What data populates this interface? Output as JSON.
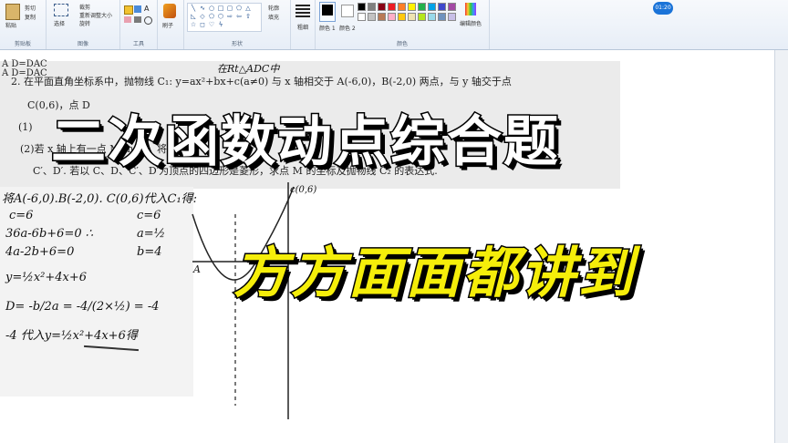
{
  "ribbon": {
    "clipboard": {
      "paste": "粘贴",
      "cut": "剪切",
      "copy": "复制",
      "label": "剪贴板"
    },
    "image": {
      "select": "选择",
      "crop": "裁剪",
      "resize": "重新调整大小",
      "rotate": "旋转",
      "label": "图像"
    },
    "tools": {
      "label": "工具"
    },
    "brushes": {
      "label": "刷子"
    },
    "shapes": {
      "outline": "轮廓",
      "fill": "填充",
      "label": "形状"
    },
    "size": {
      "label": "粗细"
    },
    "colors": {
      "color1": "颜色 1",
      "color2": "颜色 2",
      "edit": "编辑颜色",
      "label": "颜色",
      "palette": [
        "#000000",
        "#7f7f7f",
        "#880015",
        "#ed1c24",
        "#ff7f27",
        "#fff200",
        "#22b14c",
        "#00a2e8",
        "#3f48cc",
        "#a349a4",
        "#ffffff",
        "#c3c3c3",
        "#b97a57",
        "#ffaec9",
        "#ffc90e",
        "#efe4b0",
        "#b5e61d",
        "#99d9ea",
        "#7092be",
        "#c8bfe7"
      ]
    }
  },
  "clock": "01:20",
  "photo": {
    "line0": "A D=DAC",
    "line0b": "A D=DAC",
    "heading": "在Rt△ADC中",
    "line1": "2.  在平面直角坐标系中，抛物线 C₁: y=ax²+bx+c(a≠0) 与 x 轴相交于 A(-6,0)，B(-2,0) 两点，与 y 轴交于点",
    "line2": "C(0,6)，点 D",
    "line3": "(1)",
    "line4": "(2)若 x 轴上有一点 M(m,0)，将抛物线 C",
    "line5": "C′、D′. 若以 C、D、C′、D′为顶点的四边形是菱形，求点 M 的坐标及抛物线 C₂ 的表达式."
  },
  "handwriting": {
    "h1": "将A(-6,0).B(-2,0). C(0,6)代入C₁得:",
    "h2": "c=6",
    "h3": "36a-6b+6=0 ∴",
    "h4": "4a-2b+6=0",
    "h5": "y=½x²+4x+6",
    "h6": "D= -b/2a = -4/(2×½) = -4",
    "h7": "-4 代入y=½x²+4x+6得",
    "s1": "c=6",
    "s2": "a=½",
    "s3": "b=4",
    "point_c": "c(0,6)",
    "point_a": "A"
  },
  "overlay": {
    "title": "二次函数动点综合题",
    "subtitle": "方方面面都讲到"
  }
}
